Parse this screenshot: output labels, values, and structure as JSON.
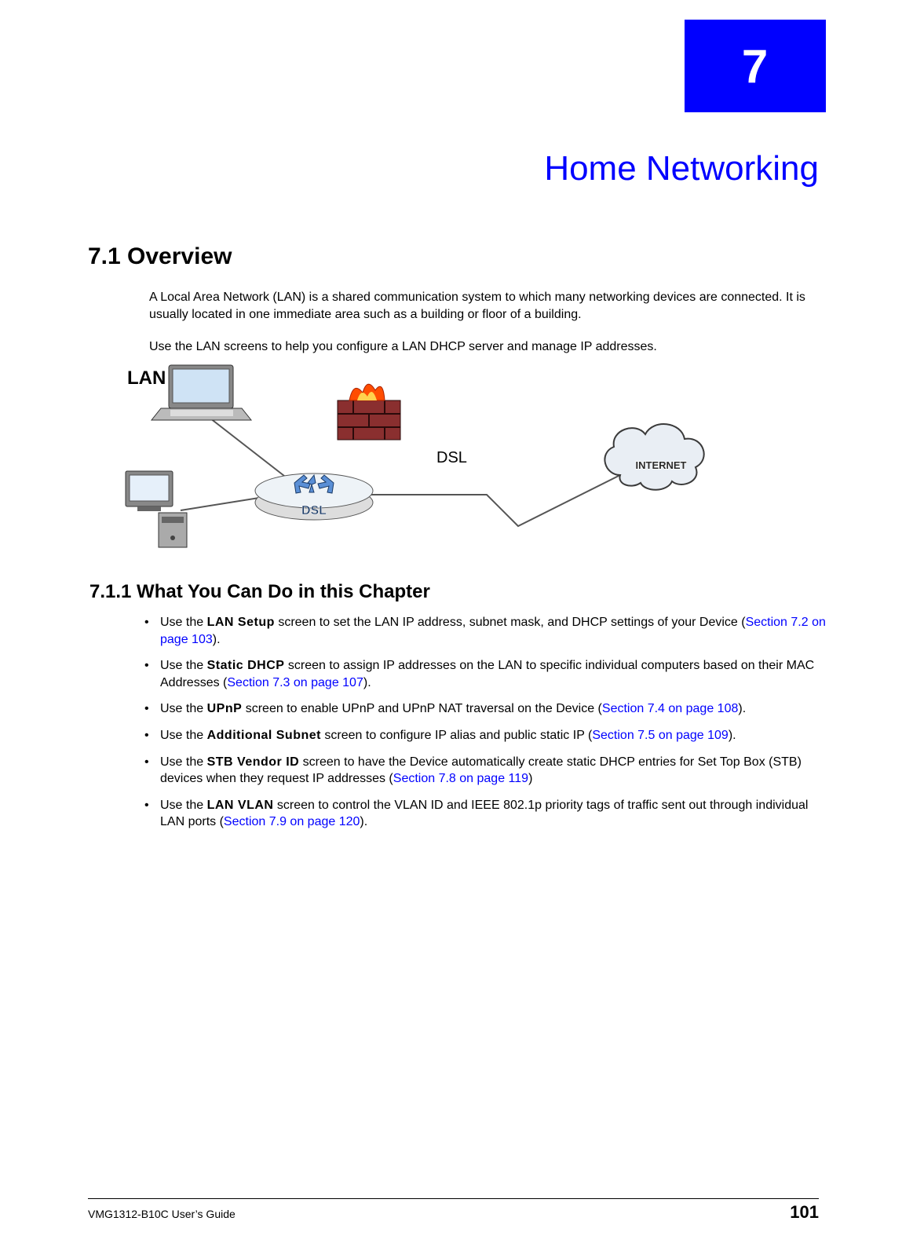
{
  "chapter": {
    "number": "7",
    "title": "Home Networking"
  },
  "section1": {
    "num_title": "7.1  Overview",
    "para1": "A Local Area Network (LAN) is a shared communication system to which many networking devices are connected. It is usually located in one immediate area such as a building or floor of a building.",
    "para2": "Use the LAN screens to help you configure a LAN DHCP server and manage IP addresses."
  },
  "diagram": {
    "lan_label": "LAN",
    "dsl_label": "DSL",
    "internet_label": "INTERNET",
    "router_label": "DSL"
  },
  "section2": {
    "num_title": "7.1.1  What You Can Do in this Chapter",
    "items": [
      {
        "pre": "Use the ",
        "bold": "LAN Setup",
        "mid": " screen to set the LAN IP address, subnet mask, and DHCP settings of your Device (",
        "link": "Section 7.2 on page 103",
        "post": ")."
      },
      {
        "pre": "Use the ",
        "bold": "Static DHCP",
        "mid": " screen to assign IP addresses on the LAN to specific individual computers based on their MAC Addresses (",
        "link": "Section 7.3 on page 107",
        "post": ")."
      },
      {
        "pre": "Use the ",
        "bold": "UPnP",
        "mid": " screen to enable UPnP and UPnP NAT traversal on the Device (",
        "link": "Section 7.4 on page 108",
        "post": ")."
      },
      {
        "pre": "Use the ",
        "bold": "Additional Subnet",
        "mid": " screen to configure IP alias and public static IP (",
        "link": "Section 7.5 on page 109",
        "post": ")."
      },
      {
        "pre": "Use the ",
        "bold": "STB Vendor ID",
        "mid": " screen to have the Device automatically create static DHCP entries for Set Top Box (STB) devices when they request IP addresses (",
        "link": "Section 7.8 on page 119",
        "post": ")"
      },
      {
        "pre": "Use the ",
        "bold": "LAN VLAN",
        "mid": " screen to control the VLAN ID and IEEE 802.1p priority tags of traffic sent out through individual LAN ports (",
        "link": "Section 7.9 on page 120",
        "post": ")."
      }
    ]
  },
  "footer": {
    "guide": "VMG1312-B10C User’s Guide",
    "page": "101"
  }
}
